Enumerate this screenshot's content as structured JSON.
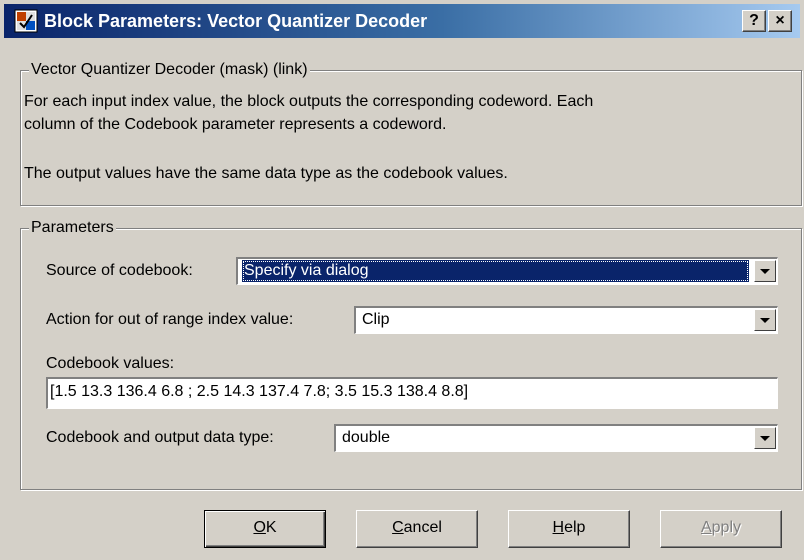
{
  "window": {
    "title": "Block Parameters: Vector Quantizer Decoder",
    "help_button": "?",
    "close_button": "×"
  },
  "description": {
    "group_title": "Vector Quantizer Decoder (mask) (link)",
    "line1": "For each input index value, the block outputs the corresponding codeword. Each",
    "line2": "column of the Codebook parameter represents a codeword.",
    "line3": "The output values have the same data type as the codebook values."
  },
  "parameters": {
    "group_title": "Parameters",
    "source_label": "Source of codebook:",
    "source_value": "Specify via dialog",
    "action_label": "Action for out of range index value:",
    "action_value": "Clip",
    "codebook_label": "Codebook values:",
    "codebook_value": "[1.5  13.3  136.4  6.8 ; 2.5  14.3  137.4  7.8; 3.5  15.3  138.4  8.8]",
    "datatype_label": "Codebook and output data type:",
    "datatype_value": "double"
  },
  "buttons": {
    "ok": {
      "mnemonic": "O",
      "rest": "K"
    },
    "cancel": {
      "mnemonic": "C",
      "rest": "ancel"
    },
    "help": {
      "mnemonic": "H",
      "rest": "elp"
    },
    "apply": {
      "mnemonic": "A",
      "rest": "pply"
    }
  },
  "colors": {
    "titlebar_start": "#0a246a",
    "titlebar_end": "#a6caf0",
    "face": "#d4d0c8",
    "selection": "#0a246a"
  }
}
